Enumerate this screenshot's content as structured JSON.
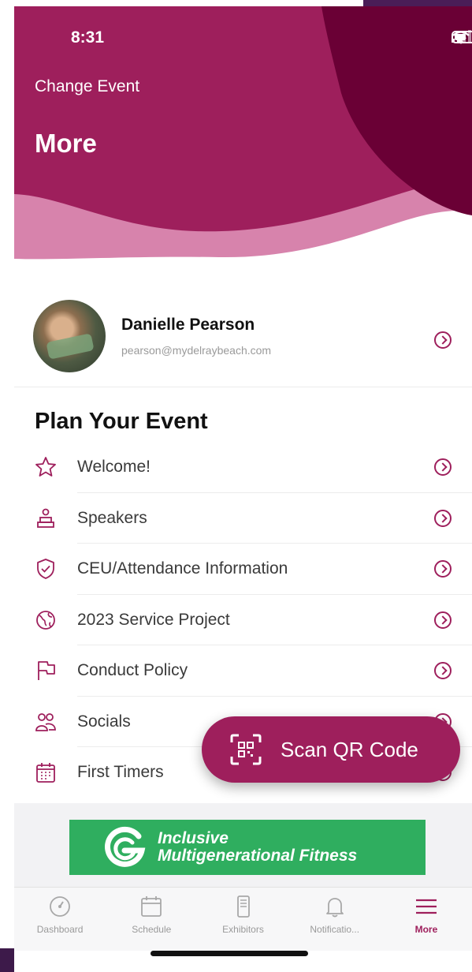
{
  "status": {
    "time": "8:31"
  },
  "header": {
    "change_event": "Change Event",
    "title": "More",
    "colors": {
      "primary": "#9e1f5c",
      "dark": "#6a0035",
      "light": "#d783ac"
    }
  },
  "profile": {
    "name": "Danielle Pearson",
    "email": "pearson@mydelraybeach.com"
  },
  "section": {
    "title": "Plan Your Event"
  },
  "menu": [
    {
      "label": "Welcome!",
      "icon": "star-icon"
    },
    {
      "label": "Speakers",
      "icon": "speaker-podium-icon"
    },
    {
      "label": "CEU/Attendance Information",
      "icon": "shield-check-icon"
    },
    {
      "label": "2023 Service Project",
      "icon": "globe-icon"
    },
    {
      "label": "Conduct Policy",
      "icon": "flag-icon"
    },
    {
      "label": "Socials",
      "icon": "people-icon"
    },
    {
      "label": "First Timers",
      "icon": "calendar-icon"
    }
  ],
  "fab": {
    "label": "Scan QR Code",
    "icon": "qr-scan-icon"
  },
  "banner": {
    "line1": "Inclusive",
    "line2": "Multigenerational Fitness",
    "color": "#2fae5f"
  },
  "tabs": [
    {
      "label": "Dashboard",
      "icon": "dashboard-icon"
    },
    {
      "label": "Schedule",
      "icon": "calendar-icon"
    },
    {
      "label": "Exhibitors",
      "icon": "exhibitors-icon"
    },
    {
      "label": "Notificatio...",
      "icon": "bell-icon"
    },
    {
      "label": "More",
      "icon": "menu-icon",
      "active": true
    }
  ]
}
